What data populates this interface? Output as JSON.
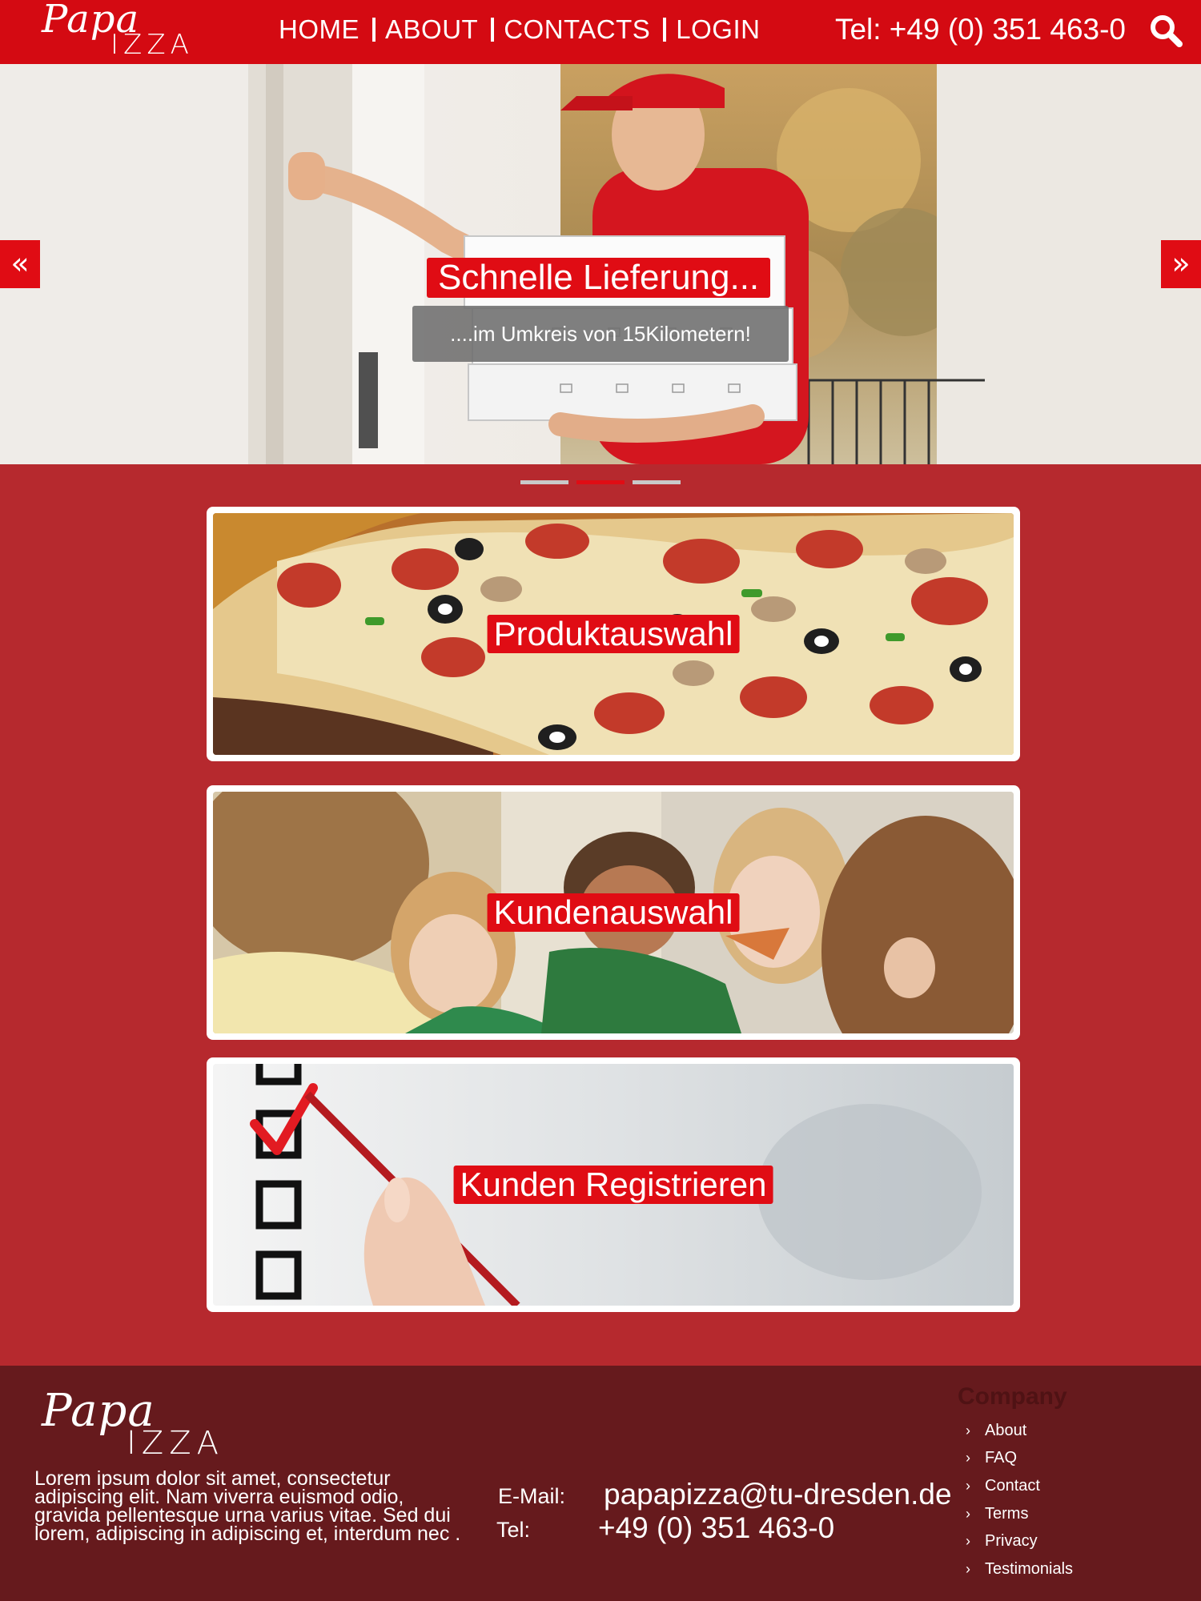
{
  "brand": {
    "logo_top": "Papa",
    "logo_bottom": "IZZA"
  },
  "nav": {
    "items": [
      {
        "label": "HOME"
      },
      {
        "label": "ABOUT"
      },
      {
        "label": "CONTACTS"
      },
      {
        "label": "LOGIN"
      }
    ],
    "phone": "Tel:  +49 (0) 351 463-0",
    "search_icon": "search-icon"
  },
  "hero": {
    "title": "Schnelle Lieferung...",
    "subtitle": "....im Umkreis von  15Kilometern!",
    "prev_icon": "double-chevron-left-icon",
    "next_icon": "double-chevron-right-icon",
    "slide_count": 3,
    "active_slide": 2
  },
  "cards": [
    {
      "label": "Produktauswahl"
    },
    {
      "label": "Kundenauswahl"
    },
    {
      "label": "Kunden Registrieren"
    }
  ],
  "footer": {
    "about_text": "Lorem ipsum dolor sit amet, consectetur adipiscing elit. Nam viverra euismod odio, gravida pellentesque urna varius vitae. Sed dui lorem, adipiscing in adipiscing et, interdum nec .",
    "email_label": "E-Mail:",
    "email_value": "papapizza@tu-dresden.de",
    "tel_label": "Tel:",
    "tel_value": "+49 (0) 351 463-0",
    "company_title": "Company",
    "company_links": [
      {
        "label": "About"
      },
      {
        "label": "FAQ"
      },
      {
        "label": "Contact"
      },
      {
        "label": "Terms"
      },
      {
        "label": "Privacy"
      },
      {
        "label": "Testimonials"
      }
    ]
  },
  "colors": {
    "brand_red": "#d40a12",
    "page_bg": "#b6292e",
    "footer_bg": "#661a1d"
  }
}
